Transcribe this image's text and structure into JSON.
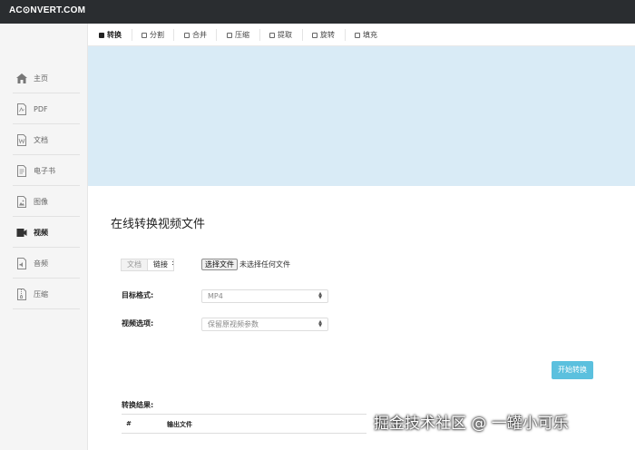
{
  "app": {
    "logo": "AC⊙NVERT.COM"
  },
  "sidebar": {
    "items": [
      {
        "label": "主页",
        "icon": "home-icon"
      },
      {
        "label": "PDF",
        "icon": "pdf-file-icon"
      },
      {
        "label": "文档",
        "icon": "word-file-icon"
      },
      {
        "label": "电子书",
        "icon": "ebook-icon"
      },
      {
        "label": "图像",
        "icon": "image-icon"
      },
      {
        "label": "视频",
        "icon": "video-icon",
        "active": true
      },
      {
        "label": "音频",
        "icon": "audio-file-icon"
      },
      {
        "label": "压缩",
        "icon": "archive-icon"
      }
    ]
  },
  "tabs": [
    {
      "label": "转换",
      "active": true
    },
    {
      "label": "分割"
    },
    {
      "label": "合并"
    },
    {
      "label": "压缩"
    },
    {
      "label": "提取"
    },
    {
      "label": "旋转"
    },
    {
      "label": "填充"
    }
  ],
  "main": {
    "title": "在线转换视频文件",
    "source": {
      "tab_file": "文档",
      "tab_link": "链接",
      "colon": ":"
    },
    "file_input": {
      "button_label": "选择文件",
      "status": "未选择任何文件"
    },
    "target_format": {
      "label": "目标格式:",
      "value": "MP4"
    },
    "video_options": {
      "label": "视频选项:",
      "value": "保留原视频参数"
    },
    "start_button": "开始转换",
    "results": {
      "label": "转换结果:",
      "columns": [
        "#",
        "输出文件"
      ]
    }
  },
  "watermark": "掘金技术社区 @ 一罐小可乐",
  "colors": {
    "topbar": "#2a2d30",
    "banner": "#d9ebf6",
    "accent": "#5bc0de"
  }
}
